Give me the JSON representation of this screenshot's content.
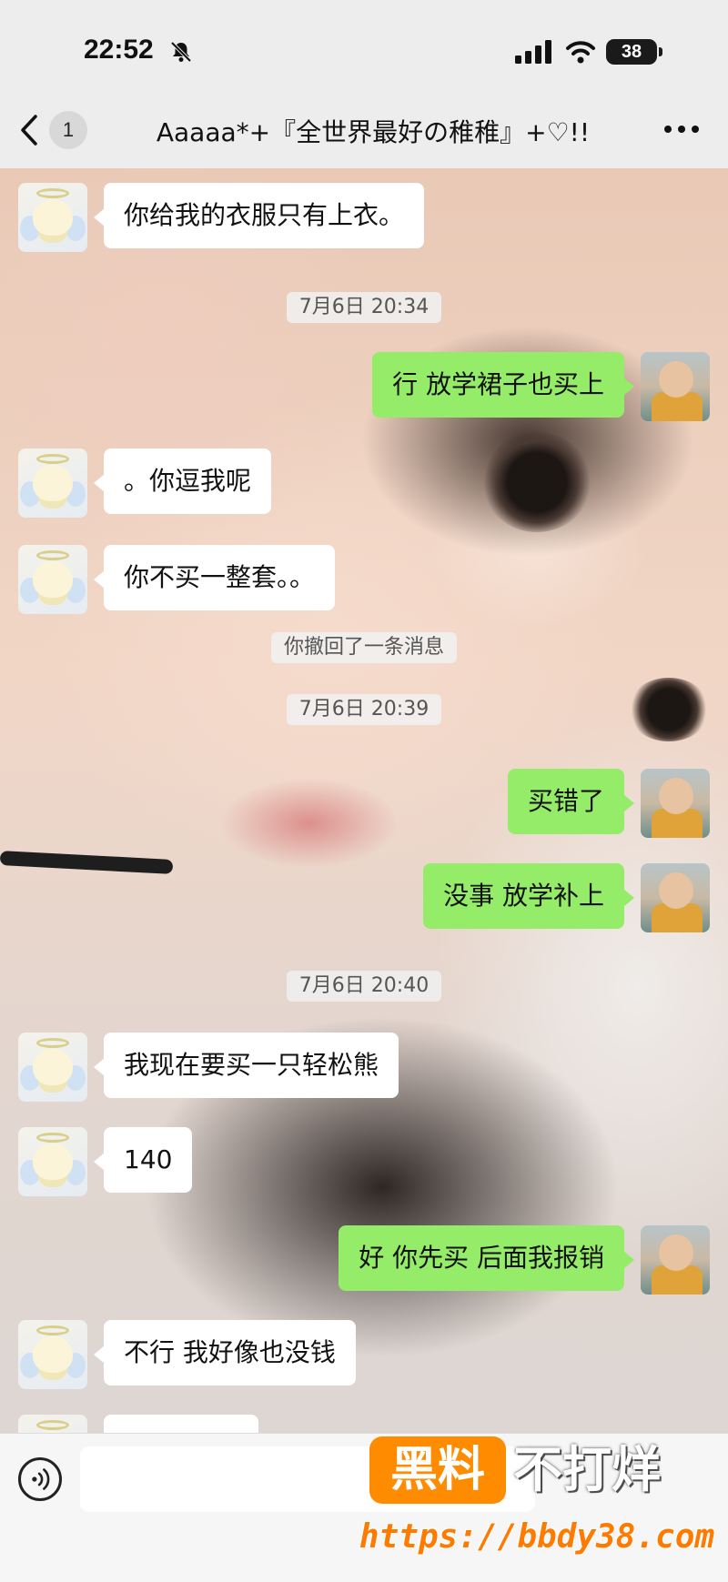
{
  "status_bar": {
    "time": "22:52",
    "battery": "38",
    "icons": [
      "bell-off-icon",
      "signal-icon",
      "wifi-icon",
      "battery-icon"
    ]
  },
  "nav": {
    "unread_count": "1",
    "title": "Aaaaa*+『全世界最好の稚稚』+♡!!",
    "icons": [
      "chevron-left-icon",
      "more-icon"
    ]
  },
  "messages": [
    {
      "type": "text",
      "side": "left",
      "text": "你给我的衣服只有上衣。"
    },
    {
      "type": "time",
      "text": "7月6日 20:34"
    },
    {
      "type": "text",
      "side": "right",
      "text": "行 放学裙子也买上"
    },
    {
      "type": "text",
      "side": "left",
      "text": "。你逗我呢"
    },
    {
      "type": "text",
      "side": "left",
      "text": "你不买一整套。。"
    },
    {
      "type": "system",
      "text": "你撤回了一条消息"
    },
    {
      "type": "time",
      "text": "7月6日 20:39"
    },
    {
      "type": "text",
      "side": "right",
      "text": "买错了"
    },
    {
      "type": "text",
      "side": "right",
      "text": "没事 放学补上"
    },
    {
      "type": "time",
      "text": "7月6日 20:40"
    },
    {
      "type": "text",
      "side": "left",
      "text": "我现在要买一只轻松熊"
    },
    {
      "type": "text",
      "side": "left",
      "text": "140"
    },
    {
      "type": "text",
      "side": "right",
      "text": "好 你先买 后面我报销"
    },
    {
      "type": "text",
      "side": "left",
      "text": "不行 我好像也没钱"
    }
  ],
  "input_bar": {
    "value": "",
    "icons": [
      "voice-icon"
    ]
  },
  "watermark": {
    "box_text": "黑料",
    "text": "不打烊",
    "url": "https://bbdy38.com",
    "accent_color": "#ff8c00"
  },
  "colors": {
    "bubble_self": "#95ec69",
    "bubble_other": "#ffffff",
    "bar_background": "#ededed"
  }
}
